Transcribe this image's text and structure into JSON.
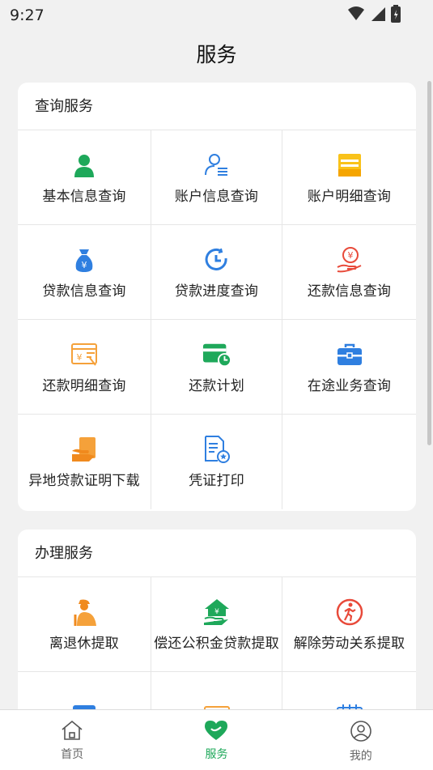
{
  "status_bar": {
    "time": "9:27"
  },
  "header": {
    "title": "服务"
  },
  "query_section": {
    "title": "查询服务",
    "items": [
      {
        "label": "基本信息查询",
        "icon": "person-icon"
      },
      {
        "label": "账户信息查询",
        "icon": "account-info-icon"
      },
      {
        "label": "账户明细查询",
        "icon": "account-detail-icon"
      },
      {
        "label": "贷款信息查询",
        "icon": "money-bag-icon"
      },
      {
        "label": "贷款进度查询",
        "icon": "clock-progress-icon"
      },
      {
        "label": "还款信息查询",
        "icon": "repayment-hand-icon"
      },
      {
        "label": "还款明细查询",
        "icon": "repayment-detail-icon"
      },
      {
        "label": "还款计划",
        "icon": "wallet-clock-icon"
      },
      {
        "label": "在途业务查询",
        "icon": "briefcase-icon"
      },
      {
        "label": "异地贷款证明下载",
        "icon": "certificate-download-icon"
      },
      {
        "label": "凭证打印",
        "icon": "voucher-print-icon"
      }
    ]
  },
  "handle_section": {
    "title": "办理服务",
    "items": [
      {
        "label": "离退休提取",
        "icon": "retiree-icon"
      },
      {
        "label": "偿还公积金贷款提取",
        "icon": "house-hand-icon"
      },
      {
        "label": "解除劳动关系提取",
        "icon": "leave-job-icon"
      }
    ]
  },
  "bottom_nav": {
    "items": [
      {
        "label": "首页",
        "icon": "home-icon"
      },
      {
        "label": "服务",
        "icon": "heart-icon"
      },
      {
        "label": "我的",
        "icon": "profile-icon"
      }
    ]
  },
  "colors": {
    "green": "#1ea85a",
    "blue": "#2f7fe0",
    "orange": "#f5a13a",
    "yellow": "#f9c21a",
    "red": "#e84a3a"
  }
}
